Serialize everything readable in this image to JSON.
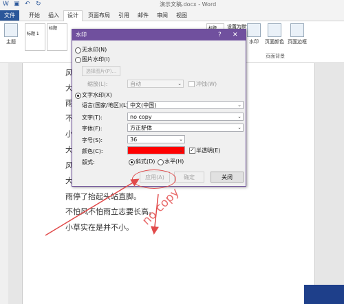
{
  "titlebar": {
    "doc_title": "演示文稿.docx - Word",
    "qat": {
      "undo": "↶",
      "redo": "↻",
      "save": "▣"
    }
  },
  "ribbon_tabs": [
    "文件",
    "开始",
    "插入",
    "设计",
    "页面布局",
    "引用",
    "邮件",
    "审阅",
    "视图"
  ],
  "active_tab": "设计",
  "ribbon": {
    "theme_label": "主题",
    "style_items": [
      "标题 1",
      "标题",
      "标题",
      "标题",
      "标题"
    ],
    "reset_label": "设置为默认值",
    "watermark_btn": "水印",
    "page_color_btn": "页面颜色",
    "page_border_btn": "页面边框",
    "page_bg_group": "页面背景"
  },
  "document_lines": [
    "风",
    "大",
    "雨",
    "不",
    "小",
    "大",
    "风",
    "大",
    "雨停了抬起头站直脚。",
    "不怕风不怕雨立志要长高。",
    "小草实在是并不小。"
  ],
  "dialog": {
    "title": "水印",
    "help": "?",
    "close": "✕",
    "no_watermark": "无水印(N)",
    "picture_watermark": "图片水印(I)",
    "select_picture": "选择图片(P)...",
    "scale_label": "缩放(L):",
    "scale_value": "自动",
    "washout_label": "冲蚀(W)",
    "text_watermark": "文字水印(X)",
    "language_label": "语言(国家/地区)(L):",
    "language_value": "中文(中国)",
    "text_label": "文字(T):",
    "text_value": "no copy",
    "font_label": "字体(F):",
    "font_value": "方正舒体",
    "size_label": "字号(S):",
    "size_value": "36",
    "color_label": "颜色(C):",
    "color_value": "#ff0000",
    "semitransparent_label": "半透明(E)",
    "layout_label": "版式:",
    "diagonal_label": "斜式(D)",
    "horizontal_label": "水平(H)",
    "apply_button": "应用(A)",
    "ok_button": "确定",
    "close_button": "关闭"
  },
  "annotation": {
    "watermark_preview_text": "no copy",
    "annotation_color": "#e14a4a"
  }
}
